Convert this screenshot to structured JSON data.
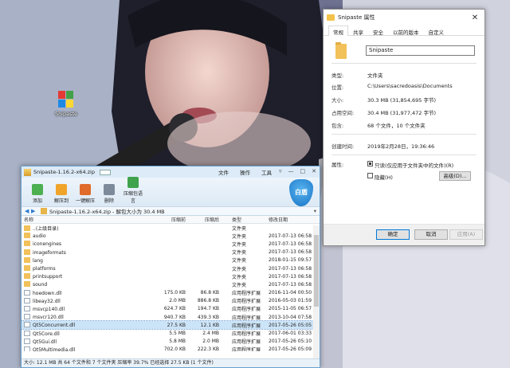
{
  "desktop": {
    "icon_label": "Snipaste"
  },
  "props": {
    "title": "Snipaste 属性",
    "tabs": [
      "常规",
      "共享",
      "安全",
      "以前的版本",
      "自定义"
    ],
    "name_value": "Snipaste",
    "rows": [
      {
        "k": "类型:",
        "v": "文件夹"
      },
      {
        "k": "位置:",
        "v": "C:\\Users\\sacredoasis\\Documents"
      },
      {
        "k": "大小:",
        "v": "30.3 MB (31,854,695 字节)"
      },
      {
        "k": "占用空间:",
        "v": "30.4 MB (31,977,472 字节)"
      },
      {
        "k": "包含:",
        "v": "68 个文件，10 个文件夹"
      },
      {
        "k": "创建时间:",
        "v": "2019年2月28日，19:36:46"
      },
      {
        "k": "属性:",
        "v": ""
      }
    ],
    "readonly_label": "只读(仅应用于文件夹中的文件)(R)",
    "hidden_label": "隐藏(H)",
    "advanced_label": "高级(D)...",
    "ok_label": "确定",
    "cancel_label": "取消",
    "apply_label": "应用(A)"
  },
  "archive": {
    "title": "Snipaste-1.16.2-x64.zip",
    "menus": [
      "文件",
      "操作",
      "工具"
    ],
    "tools": [
      {
        "label": "添加",
        "color": "#4caf50"
      },
      {
        "label": "解压到",
        "color": "#f0a42a"
      },
      {
        "label": "一键解压",
        "color": "#e06b2a"
      },
      {
        "label": "删除",
        "color": "#7d8a99"
      },
      {
        "label": "压缩包语言",
        "color": "#3fa34d"
      }
    ],
    "shield_label": "白盾",
    "path_text": "Snipaste-1.16.2-x64.zip - 解包大小为 30.4 MB",
    "columns": [
      "名称",
      "压缩前",
      "压缩后",
      "类型",
      "修改日期"
    ],
    "files": [
      {
        "name": "..(上级目录)",
        "size": "",
        "comp": "",
        "type": "文件夹",
        "date": "",
        "icon": "up"
      },
      {
        "name": "audio",
        "size": "",
        "comp": "",
        "type": "文件夹",
        "date": "2017-07-13 06:58",
        "icon": "folder"
      },
      {
        "name": "iconengines",
        "size": "",
        "comp": "",
        "type": "文件夹",
        "date": "2017-07-13 06:58",
        "icon": "folder"
      },
      {
        "name": "imageformats",
        "size": "",
        "comp": "",
        "type": "文件夹",
        "date": "2017-07-13 06:58",
        "icon": "folder"
      },
      {
        "name": "lang",
        "size": "",
        "comp": "",
        "type": "文件夹",
        "date": "2018-01-15 09:57",
        "icon": "folder"
      },
      {
        "name": "platforms",
        "size": "",
        "comp": "",
        "type": "文件夹",
        "date": "2017-07-13 06:58",
        "icon": "folder"
      },
      {
        "name": "printsupport",
        "size": "",
        "comp": "",
        "type": "文件夹",
        "date": "2017-07-13 06:58",
        "icon": "folder"
      },
      {
        "name": "sound",
        "size": "",
        "comp": "",
        "type": "文件夹",
        "date": "2017-07-13 06:58",
        "icon": "folder"
      },
      {
        "name": "hoedown.dll",
        "size": "175.0 KB",
        "comp": "86.8 KB",
        "type": "应用程序扩展",
        "date": "2016-11-04 00:50",
        "icon": "dll"
      },
      {
        "name": "libeay32.dll",
        "size": "2.0 MB",
        "comp": "886.8 KB",
        "type": "应用程序扩展",
        "date": "2016-05-03 01:59",
        "icon": "dll"
      },
      {
        "name": "msvcp140.dll",
        "size": "624.7 KB",
        "comp": "194.7 KB",
        "type": "应用程序扩展",
        "date": "2015-11-05 06:57",
        "icon": "dll"
      },
      {
        "name": "msvcr120.dll",
        "size": "940.7 KB",
        "comp": "439.3 KB",
        "type": "应用程序扩展",
        "date": "2013-10-04 07:58",
        "icon": "dll"
      },
      {
        "name": "Qt5Concurrent.dll",
        "size": "27.5 KB",
        "comp": "12.1 KB",
        "type": "应用程序扩展",
        "date": "2017-05-26 05:05",
        "icon": "dll",
        "selected": true
      },
      {
        "name": "Qt5Core.dll",
        "size": "5.5 MB",
        "comp": "2.4 MB",
        "type": "应用程序扩展",
        "date": "2017-06-01 03:33",
        "icon": "dll"
      },
      {
        "name": "Qt5Gui.dll",
        "size": "5.8 MB",
        "comp": "2.0 MB",
        "type": "应用程序扩展",
        "date": "2017-05-26 05:10",
        "icon": "dll"
      },
      {
        "name": "Qt5Multimedia.dll",
        "size": "702.0 KB",
        "comp": "222.3 KB",
        "type": "应用程序扩展",
        "date": "2017-05-26 05:09",
        "icon": "dll"
      },
      {
        "name": "Qt5Network.dll",
        "size": "",
        "comp": "",
        "type": "",
        "date": "",
        "icon": "dll"
      }
    ],
    "status_text": "大小: 12.1 MB 共 64 个文件和 7 个文件夹 压缩率 39.7% 已经选择 27.5 KB (1 个文件)"
  }
}
